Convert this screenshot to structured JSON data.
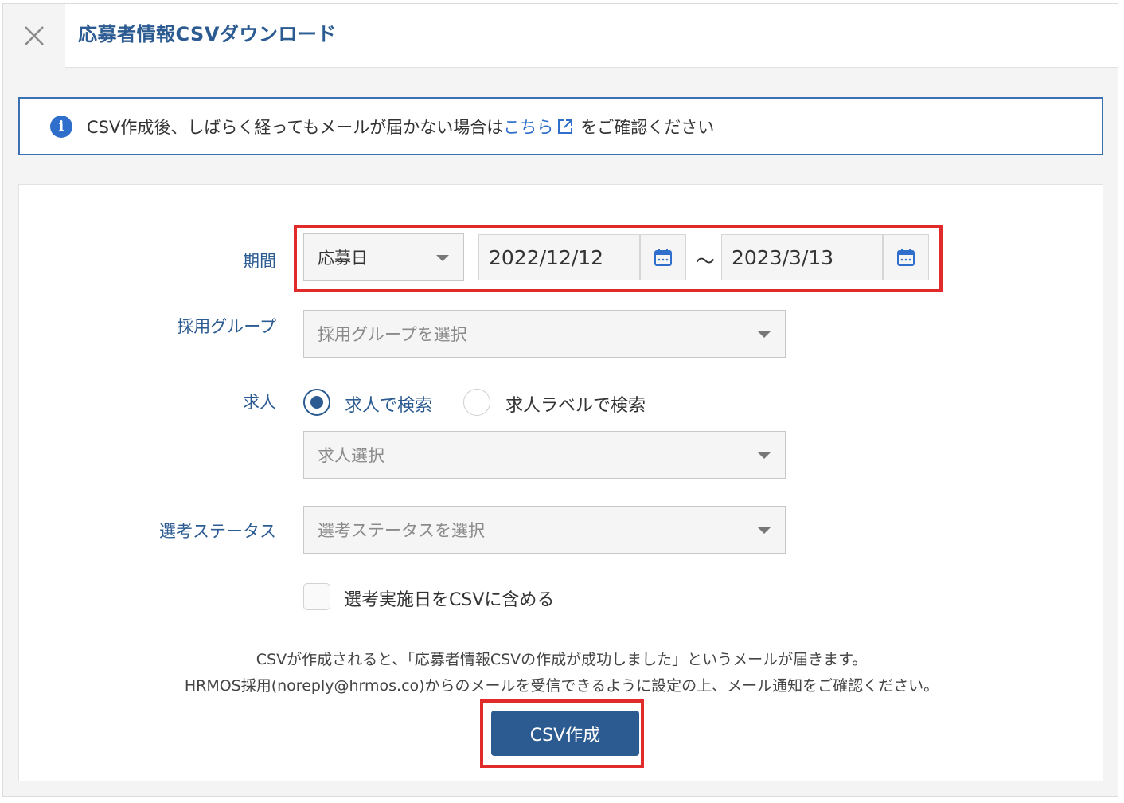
{
  "header": {
    "title": "応募者情報CSVダウンロード",
    "close_icon": "close-icon"
  },
  "info": {
    "icon": "info-icon",
    "text_before": "CSV作成後、しばらく経ってもメールが届かない場合は",
    "link_text": "こちら",
    "link_icon": "external-link-icon",
    "text_after": "をご確認ください"
  },
  "form": {
    "period": {
      "label": "期間",
      "type_selected": "応募日",
      "start_date": "2022/12/12",
      "separator": "〜",
      "end_date": "2023/3/13",
      "calendar_icon": "calendar-icon"
    },
    "group": {
      "label": "採用グループ",
      "placeholder": "採用グループを選択"
    },
    "job": {
      "label": "求人",
      "radio_options": [
        {
          "label": "求人で検索",
          "checked": true
        },
        {
          "label": "求人ラベルで検索",
          "checked": false
        }
      ],
      "placeholder": "求人選択"
    },
    "status": {
      "label": "選考ステータス",
      "placeholder": "選考ステータスを選択"
    },
    "include_dates": {
      "label": "選考実施日をCSVに含める",
      "checked": false
    }
  },
  "notes": {
    "line1": "CSVが作成されると、「応募者情報CSVの作成が成功しました」というメールが届きます。",
    "line2": "HRMOS採用(noreply@hrmos.co)からのメールを受信できるように設定の上、メール通知をご確認ください。"
  },
  "actions": {
    "create_label": "CSV作成"
  },
  "colors": {
    "primary": "#2b5b91",
    "link": "#2f6fcb",
    "highlight": "#e12b2b"
  }
}
